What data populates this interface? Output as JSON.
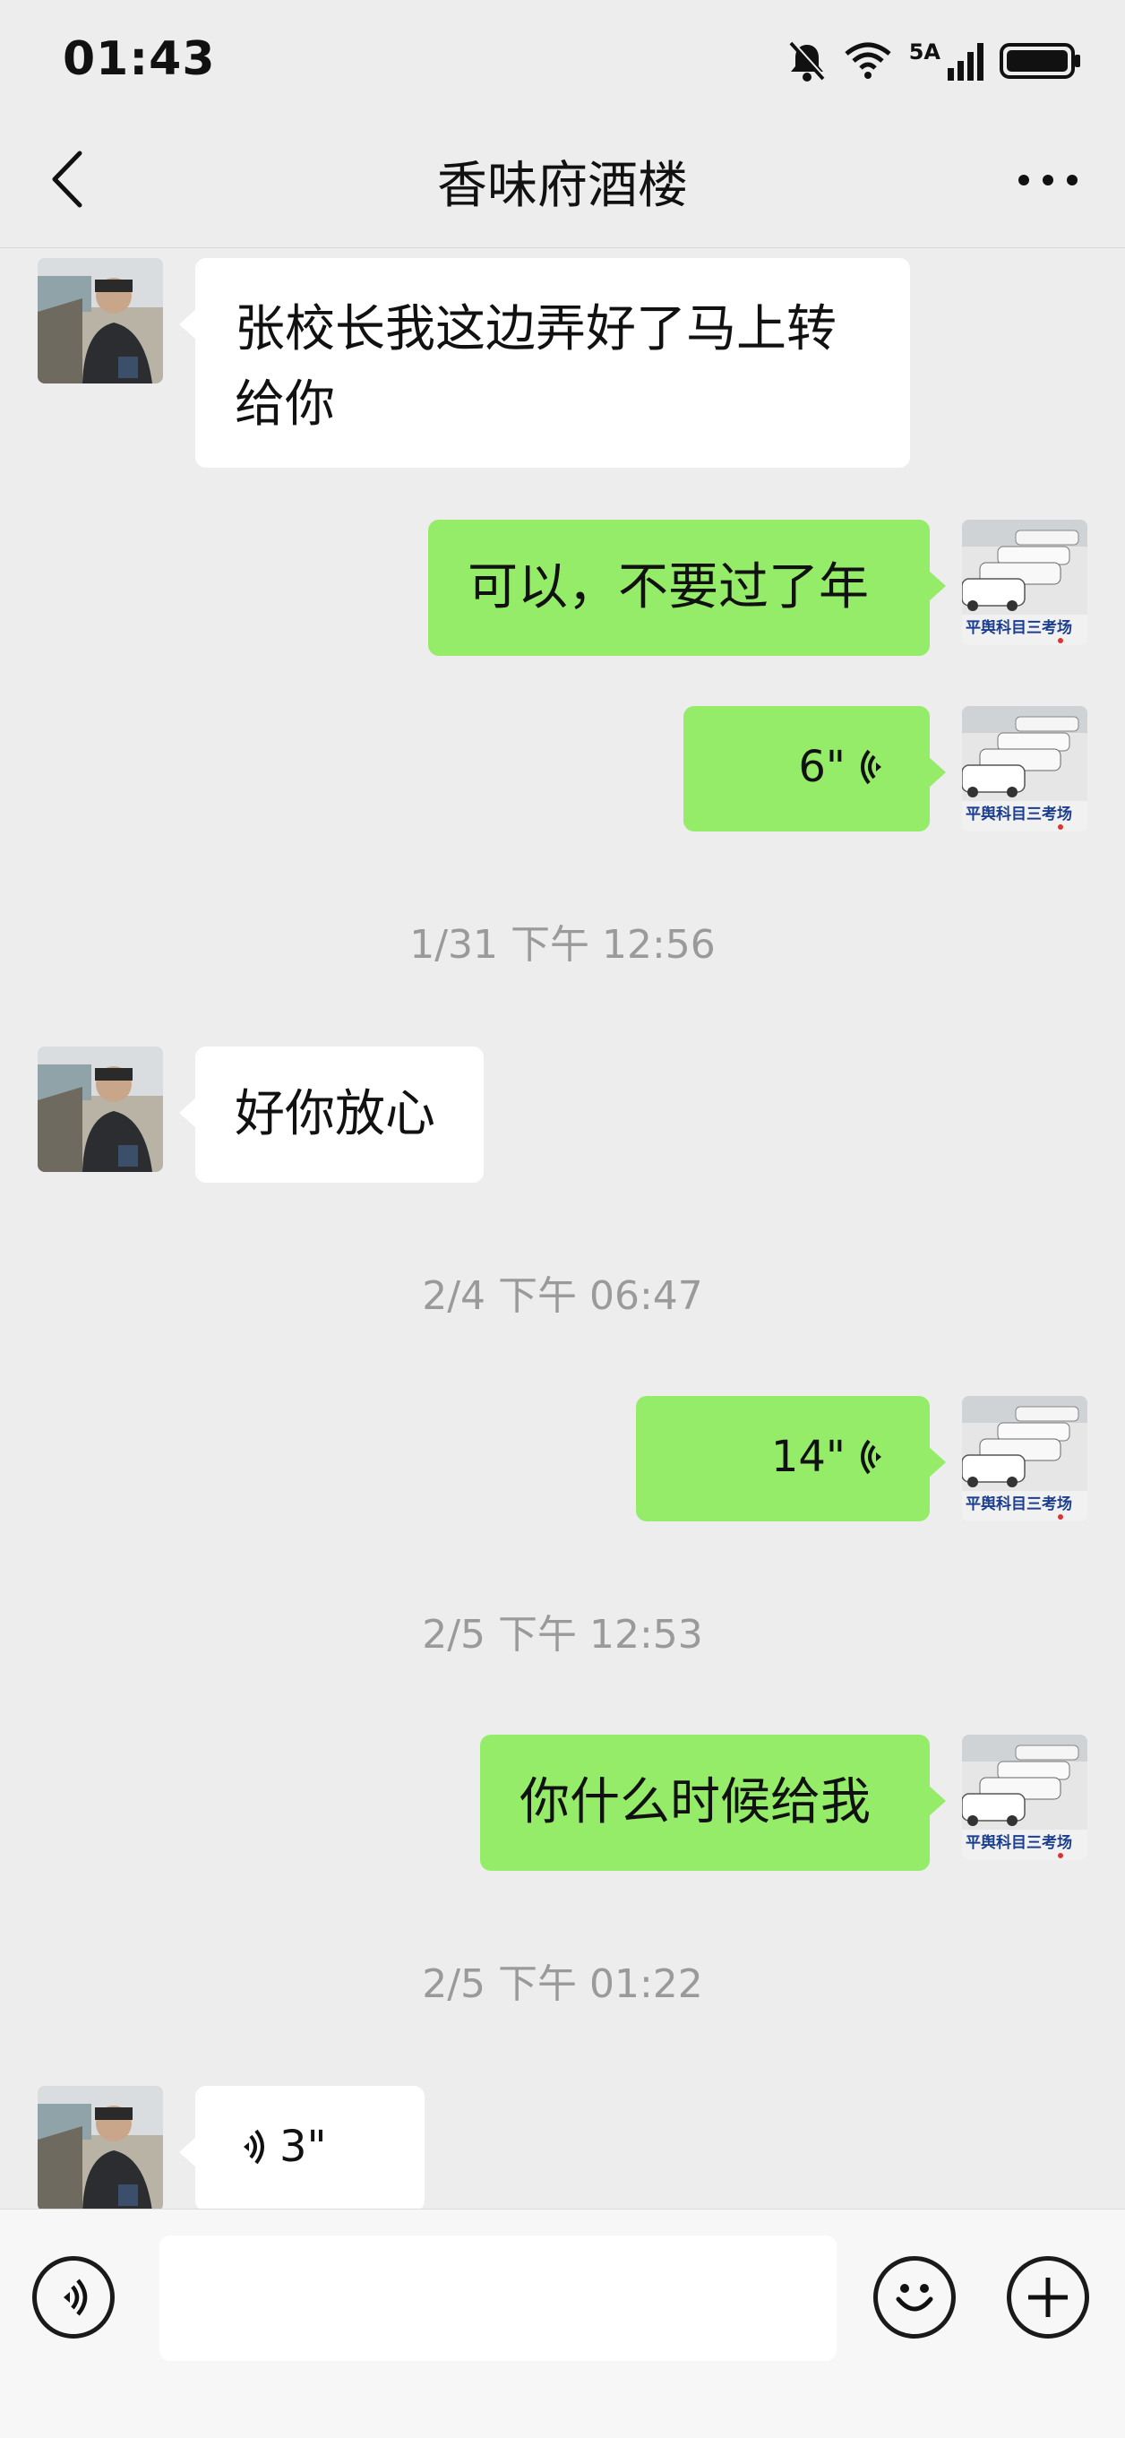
{
  "status_bar": {
    "time": "01:43",
    "network_badge": "5A",
    "icons": [
      "bell-muted-icon",
      "wifi-icon",
      "signal-icon",
      "battery-icon"
    ]
  },
  "header": {
    "title": "香味府酒楼",
    "back_icon": "chevron-left-icon",
    "more_icon": "more-dots-icon"
  },
  "messages": [
    {
      "side": "in",
      "type": "text",
      "text": "张校长我这边弄好了马上转给你"
    },
    {
      "side": "out",
      "type": "text",
      "text": "可以，不要过了年"
    },
    {
      "side": "out",
      "type": "voice",
      "duration": "6\""
    },
    {
      "type": "timestamp",
      "text": "1/31 下午 12:56"
    },
    {
      "side": "in",
      "type": "text",
      "text": "好你放心"
    },
    {
      "type": "timestamp",
      "text": "2/4 下午 06:47"
    },
    {
      "side": "out",
      "type": "voice",
      "duration": "14\""
    },
    {
      "type": "timestamp",
      "text": "2/5 下午 12:53"
    },
    {
      "side": "out",
      "type": "text",
      "text": "你什么时候给我"
    },
    {
      "type": "timestamp",
      "text": "2/5 下午 01:22"
    },
    {
      "side": "in",
      "type": "voice",
      "duration": "3\""
    }
  ],
  "avatars": {
    "contact": "contact-avatar-driver-photo",
    "self_caption": "平舆科目三考场"
  },
  "input_bar": {
    "voice_icon": "voice-input-icon",
    "emoji_icon": "emoji-icon",
    "plus_icon": "plus-icon",
    "input_value": ""
  },
  "colors": {
    "background": "#ededed",
    "outgoing_bubble": "#95ec69",
    "incoming_bubble": "#ffffff",
    "timestamp_text": "#9a9a9a"
  }
}
